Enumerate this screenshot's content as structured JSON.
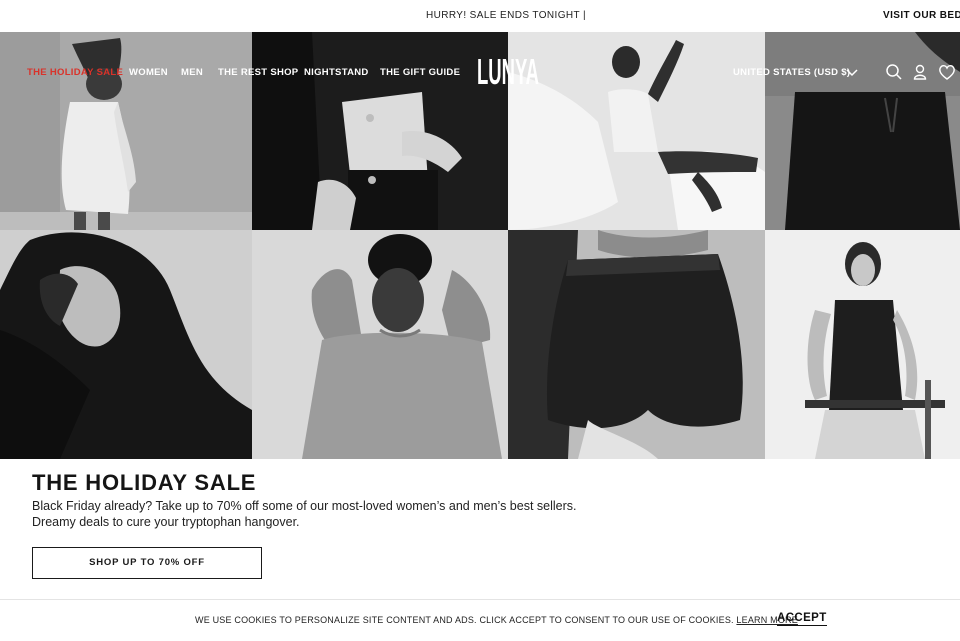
{
  "announcement": {
    "text": "HURRY! SALE ENDS TONIGHT |",
    "link": "VISIT OUR BEDRO"
  },
  "nav": {
    "items": [
      {
        "label": "THE HOLIDAY SALE",
        "highlight": true
      },
      {
        "label": "WOMEN"
      },
      {
        "label": "MEN"
      },
      {
        "label": "THE REST SHOP"
      },
      {
        "label": "NIGHTSTAND"
      },
      {
        "label": "THE GIFT GUIDE"
      }
    ],
    "logo": "LUNYA",
    "region": "UNITED STATES (USD $)",
    "icons": [
      "chevron-down-icon",
      "search-icon",
      "account-icon",
      "heart-icon"
    ]
  },
  "hero": {
    "photos": [
      "woman-white-satin-dress",
      "woman-black-cardigan",
      "woman-reclining-pillow",
      "man-black-shorts",
      "woman-black-hood",
      "man-grey-sweater",
      "woman-black-satin-shorts",
      "woman-black-tank-chair"
    ]
  },
  "content": {
    "headline": "THE HOLIDAY SALE",
    "description_line1": "Black Friday already? Take up to 70% off some of our most-loved women’s and men’s best sellers.",
    "description_line2": "Dreamy deals to cure your tryptophan hangover.",
    "cta": "SHOP UP TO 70% OFF"
  },
  "cookie": {
    "text": "WE USE COOKIES TO PERSONALIZE SITE CONTENT AND ADS. CLICK ACCEPT TO CONSENT TO OUR USE OF COOKIES.",
    "link": "LEARN MORE",
    "accept": "ACCEPT"
  },
  "colors": {
    "accent": "#d9322a",
    "text": "#1a1a1a",
    "background": "#ffffff"
  }
}
